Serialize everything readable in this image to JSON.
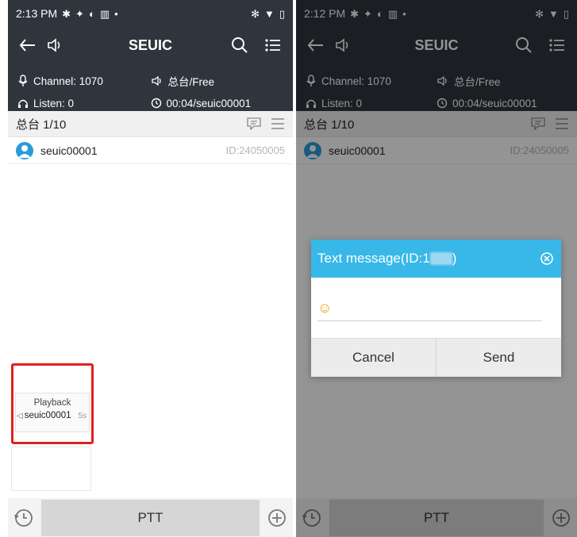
{
  "colors": {
    "appbar_bg": "#2f353c",
    "accent_blue": "#38b8e8",
    "highlight_red": "#e02020",
    "ptt_bg": "#d6d6d6"
  },
  "left": {
    "status": {
      "time": "2:13 PM"
    },
    "appbar": {
      "title": "SEUIC"
    },
    "info": {
      "channel": "Channel: 1070",
      "listen": "Listen: 0",
      "group_status": "总台/Free",
      "last_talk": "00:04/seuic00001"
    },
    "group": {
      "title": "总台 1/10"
    },
    "member": {
      "name": "seuic00001",
      "id": "ID:24050005"
    },
    "playback": {
      "title": "Playback",
      "name": "seuic00001",
      "duration": "5s"
    },
    "bottom": {
      "ptt_label": "PTT"
    }
  },
  "right": {
    "status": {
      "time": "2:12 PM"
    },
    "appbar": {
      "title": "SEUIC"
    },
    "info": {
      "channel": "Channel: 1070",
      "listen": "Listen: 0",
      "group_status": "总台/Free",
      "last_talk": "00:04/seuic00001"
    },
    "group": {
      "title": "总台 1/10"
    },
    "member": {
      "name": "seuic00001",
      "id": "ID:24050005"
    },
    "dialog": {
      "title_prefix": "Text message(ID:1",
      "title_suffix": ")",
      "input_value": "☺",
      "cancel_label": "Cancel",
      "send_label": "Send"
    },
    "bottom": {
      "ptt_label": "PTT"
    }
  },
  "icons": [
    "gear-icon",
    "signal-icon",
    "cast-icon",
    "battery-saver-icon",
    "bluetooth-icon",
    "wifi-icon",
    "battery-icon",
    "back-arrow-icon",
    "speaker-icon",
    "search-icon",
    "list-menu-icon",
    "microphone-icon",
    "headphones-icon",
    "clock-icon",
    "message-icon",
    "hamburger-icon",
    "user-avatar-icon",
    "history-icon",
    "plus-circle-icon",
    "close-circle-icon"
  ]
}
